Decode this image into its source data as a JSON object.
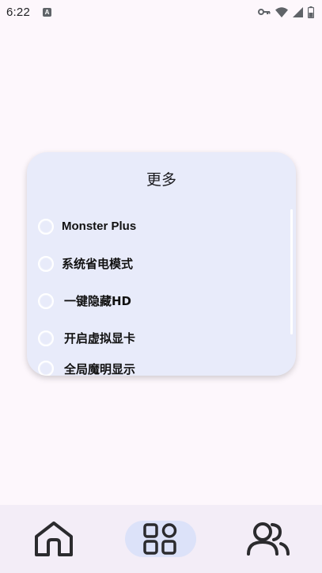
{
  "status_bar": {
    "time": "6:22",
    "notification_letter": "A",
    "icons": [
      "key-icon",
      "wifi-icon",
      "signal-icon",
      "battery-icon"
    ]
  },
  "dialog": {
    "title": "更多",
    "options": [
      {
        "label": "Monster Plus",
        "selected": false
      },
      {
        "label": "系统省电模式",
        "selected": false
      },
      {
        "label": "一键隐藏HD",
        "selected": false
      },
      {
        "label": "开启虚拟显卡",
        "selected": false
      },
      {
        "label": "全局魔明显示",
        "selected": false
      }
    ]
  },
  "bottom_nav": {
    "items": [
      {
        "icon": "home-icon",
        "active": false
      },
      {
        "icon": "apps-grid-icon",
        "active": true
      },
      {
        "icon": "users-icon",
        "active": false
      }
    ]
  },
  "colors": {
    "background": "#fdf7fc",
    "dialog": "#e8ebfa",
    "nav_bar": "#f3edf7",
    "nav_active": "#dce2f9"
  }
}
